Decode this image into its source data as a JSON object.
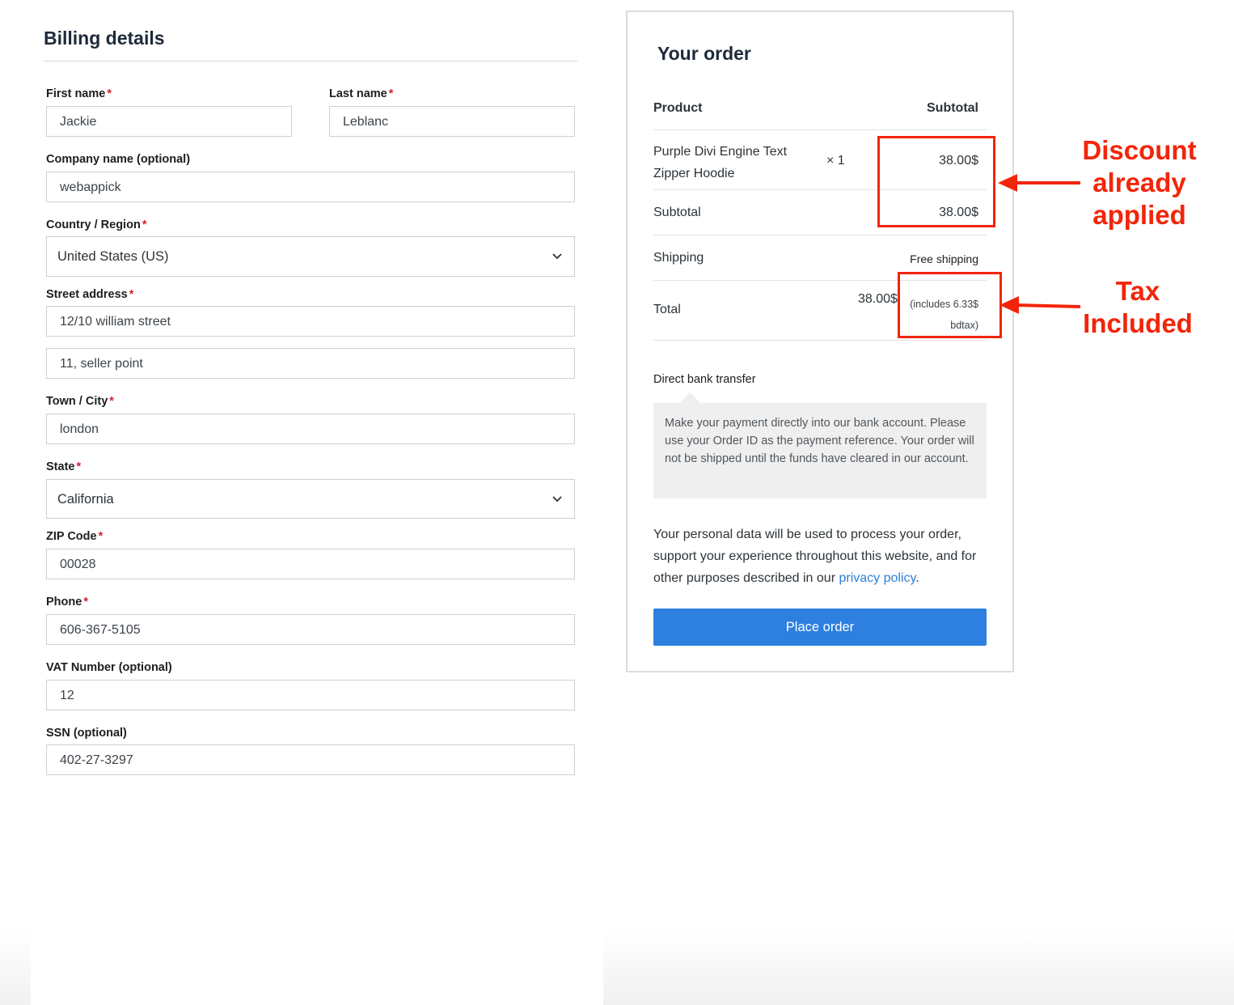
{
  "billing": {
    "title": "Billing details",
    "required_mark": "*",
    "first_name": {
      "label": "First name",
      "value": "Jackie"
    },
    "last_name": {
      "label": "Last name",
      "value": "Leblanc"
    },
    "company": {
      "label": "Company name (optional)",
      "value": "webappick"
    },
    "country": {
      "label": "Country / Region",
      "value": "United States (US)"
    },
    "street": {
      "label": "Street address",
      "value1": "12/10 william street",
      "value2": "11, seller point"
    },
    "city": {
      "label": "Town / City",
      "value": "london"
    },
    "state": {
      "label": "State",
      "value": "California"
    },
    "zip": {
      "label": "ZIP Code",
      "value": "00028"
    },
    "phone": {
      "label": "Phone",
      "value": "606-367-5105"
    },
    "vat": {
      "label": "VAT Number (optional)",
      "value": "12"
    },
    "ssn": {
      "label": "SSN (optional)",
      "value": "402-27-3297"
    }
  },
  "order": {
    "title": "Your order",
    "col_product": "Product",
    "col_subtotal": "Subtotal",
    "item_name_line1": "Purple Divi Engine Text",
    "item_name_line2": "Zipper Hoodie",
    "item_qty": "× 1",
    "item_price": "38.00$",
    "subtotal_label": "Subtotal",
    "subtotal_value": "38.00$",
    "shipping_label": "Shipping",
    "shipping_value": "Free shipping",
    "total_label": "Total",
    "total_value": "38.00$",
    "tax_note_line1": "(includes 6.33$",
    "tax_note_line2": "bdtax)",
    "payment_method": "Direct bank transfer",
    "payment_description": "Make your payment directly into our bank account. Please use your Order ID as the payment reference. Your order will not be shipped until the funds have cleared in our account.",
    "privacy_text": "Your personal data will be used to process your order, support your experience throughout this website, and for other purposes described in our",
    "privacy_link": "privacy policy",
    "privacy_end": ".",
    "place_order": "Place order"
  },
  "annotations": {
    "discount_line1": "Discount",
    "discount_line2": "already",
    "discount_line3": "applied",
    "tax_line1": "Tax",
    "tax_line2": "Included",
    "color": "#f2250a"
  }
}
